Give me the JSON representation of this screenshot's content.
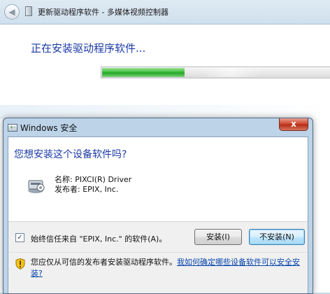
{
  "wizard": {
    "title": "更新驱动程序软件 - 多媒体视频控制器",
    "heading": "正在安装驱动程序软件...",
    "back_icon": "back-arrow-icon",
    "progress": 0.35
  },
  "dialog": {
    "title": "Windows 安全",
    "close_label": "x",
    "question": "您想安装这个设备软件吗?",
    "name_line": "名称: PIXCI(R) Driver",
    "publisher_line": "发布者: EPIX, Inc.",
    "trust_label": "始终信任来自 \"EPIX, Inc.\" 的软件(A)。",
    "trust_checked": true,
    "install_label": "安装(I)",
    "dont_install_label": "不安装(N)",
    "warning_text": "您应仅从可信的发布者安装驱动程序软件。",
    "warning_link": "我如何确定哪些设备软件可以安全安装?",
    "colors": {
      "heading_blue": "#1a3aa6",
      "link_blue": "#0645ad",
      "close_red": "#c7432b",
      "progress_green": "#3fbf3c"
    }
  }
}
